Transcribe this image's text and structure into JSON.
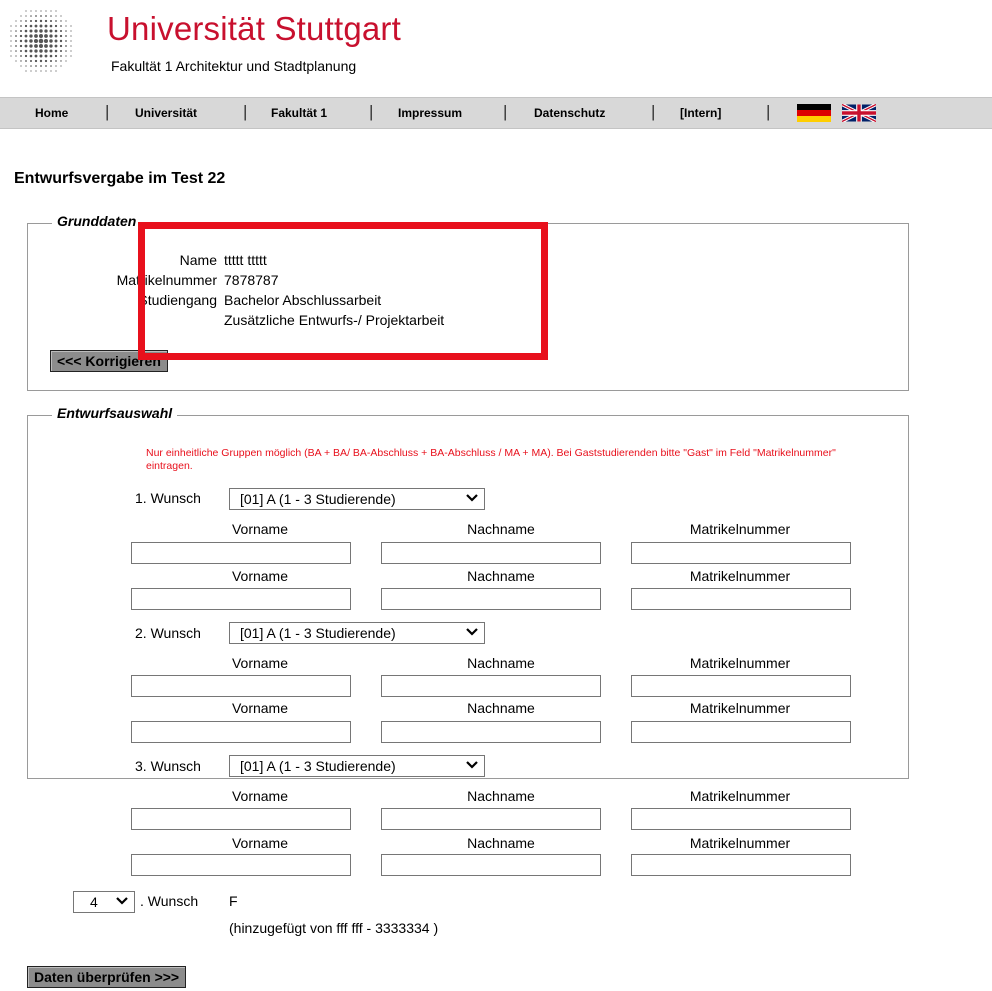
{
  "header": {
    "university": "Universität Stuttgart",
    "faculty": "Fakultät 1 Architektur und Stadtplanung"
  },
  "nav": {
    "items": [
      "Home",
      "Universität",
      "Fakultät 1",
      "Impressum",
      "Datenschutz",
      "[Intern]"
    ],
    "separator": "|"
  },
  "page": {
    "title": "Entwurfsvergabe im Test 22"
  },
  "grunddaten": {
    "legend": "Grunddaten",
    "name_label": "Name",
    "name_value": "ttttt ttttt",
    "matrikel_label": "Matrikelnummer",
    "matrikel_value": "7878787",
    "studiengang_label": "Studiengang",
    "studiengang_value1": "Bachelor Abschlussarbeit",
    "studiengang_value2": "Zusätzliche Entwurfs-/ Projektarbeit",
    "back_button": "<<< Korrigieren"
  },
  "entwurfsauswahl": {
    "legend": "Entwurfsauswahl",
    "hint": "Nur einheitliche Gruppen möglich (BA + BA/ BA-Abschluss + BA-Abschluss / MA + MA). Bei Gaststudierenden bitte \"Gast\" im Feld \"Matrikelnummer\" eintragen.",
    "columns": {
      "first": "Vorname",
      "last": "Nachname",
      "matrikel": "Matrikelnummer"
    },
    "wishes": [
      {
        "label": "1. Wunsch",
        "selected": "[01] A (1 - 3 Studierende)"
      },
      {
        "label": "2. Wunsch",
        "selected": "[01] A (1 - 3 Studierende)"
      },
      {
        "label": "3. Wunsch",
        "selected": "[01] A (1 - 3 Studierende)"
      }
    ],
    "extra_wish": {
      "number": "4",
      "label": ". Wunsch",
      "value": "F",
      "note": "(hinzugefügt von fff fff - 3333334 )"
    }
  },
  "submit_button": "Daten überprüfen >>>",
  "colors": {
    "brand_red": "#c8102e",
    "highlight_red": "#e8101c",
    "nav_bg": "#d8d8d8",
    "button_bg": "#8c8c8c"
  },
  "icons": {
    "logo": "university-dot-logo",
    "flag_de": "german-flag-icon",
    "flag_en": "uk-flag-icon",
    "dropdown": "chevron-down-icon"
  }
}
